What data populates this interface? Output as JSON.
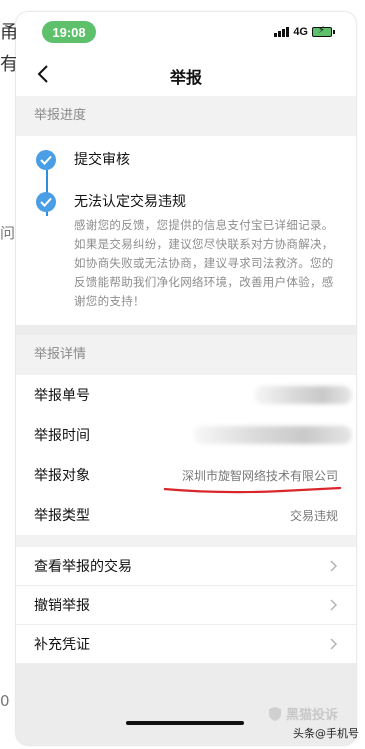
{
  "background_text": [
    "甬",
    "有",
    "问",
    "0"
  ],
  "status_bar": {
    "time": "19:08",
    "network": "4G"
  },
  "nav": {
    "title": "举报"
  },
  "progress": {
    "section_label": "举报进度",
    "steps": [
      {
        "title": "提交审核",
        "desc": ""
      },
      {
        "title": "无法认定交易违规",
        "desc": "感谢您的反馈，您提供的信息支付宝已详细记录。如果是交易纠纷，建议您尽快联系对方协商解决，如协商失败或无法协商，建议寻求司法救济。您的反馈能帮助我们净化网络环境，改善用户体验，感谢您的支持！"
      }
    ]
  },
  "details": {
    "section_label": "举报详情",
    "rows": [
      {
        "label": "举报单号",
        "value": ""
      },
      {
        "label": "举报时间",
        "value": ""
      },
      {
        "label": "举报对象",
        "value": "深圳市旋智网络技术有限公司"
      },
      {
        "label": "举报类型",
        "value": "交易违规"
      }
    ]
  },
  "actions": [
    {
      "label": "查看举报的交易"
    },
    {
      "label": "撤销举报"
    },
    {
      "label": "补充凭证"
    }
  ],
  "watermark": {
    "text": "黑猫投诉"
  },
  "source_tag": {
    "text": "头条@手机号"
  },
  "colors": {
    "accent": "#4a9ee6",
    "time_pill": "#5ec06b",
    "underline": "#d9262b"
  }
}
